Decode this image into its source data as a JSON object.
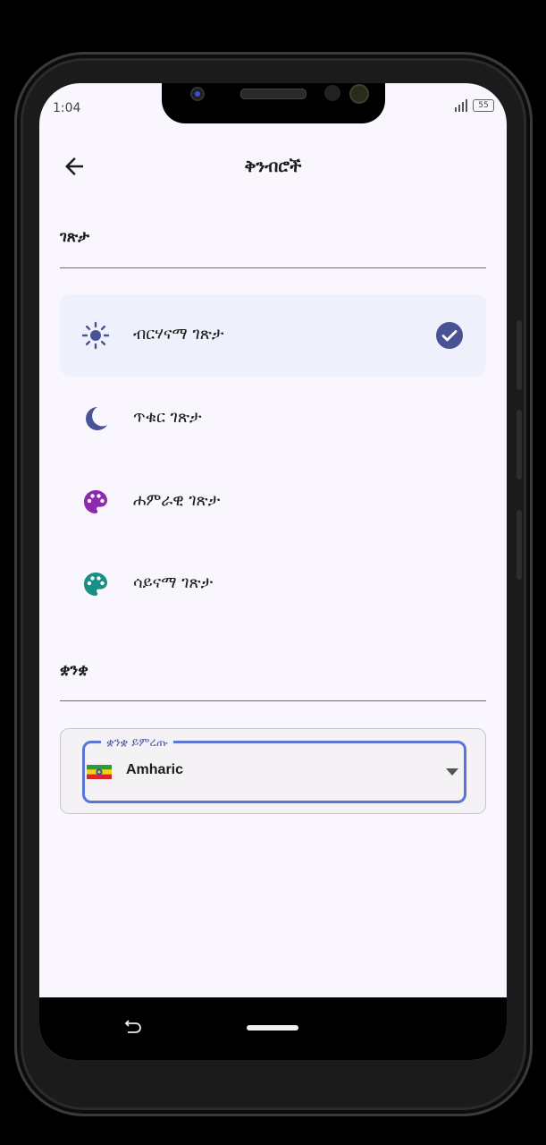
{
  "status_bar": {
    "time": "1:04",
    "battery": "55"
  },
  "app_bar": {
    "title": "ቅንብሮች",
    "back_icon": "arrow-back-icon"
  },
  "theme_section": {
    "title": "ገጽታ",
    "options": [
      {
        "label": "ብርሃናማ ገጽታ",
        "icon": "sun-icon",
        "icon_color": "#4a5296",
        "selected": true
      },
      {
        "label": "ጥቁር ገጽታ",
        "icon": "moon-icon",
        "icon_color": "#4a5296",
        "selected": false
      },
      {
        "label": "ሐምራዊ ገጽታ",
        "icon": "palette-icon",
        "icon_color": "#8e29b0",
        "selected": false
      },
      {
        "label": "ሳይናማ ገጽታ",
        "icon": "palette-icon",
        "icon_color": "#1a8f86",
        "selected": false
      }
    ]
  },
  "language_section": {
    "title": "ቋንቋ",
    "field_label": "ቋንቋ ይምረጡ",
    "selected_value": "Amharic"
  },
  "colors": {
    "accent": "#5a74d8",
    "selected_bg": "#eef0fb",
    "check": "#4a5296"
  }
}
